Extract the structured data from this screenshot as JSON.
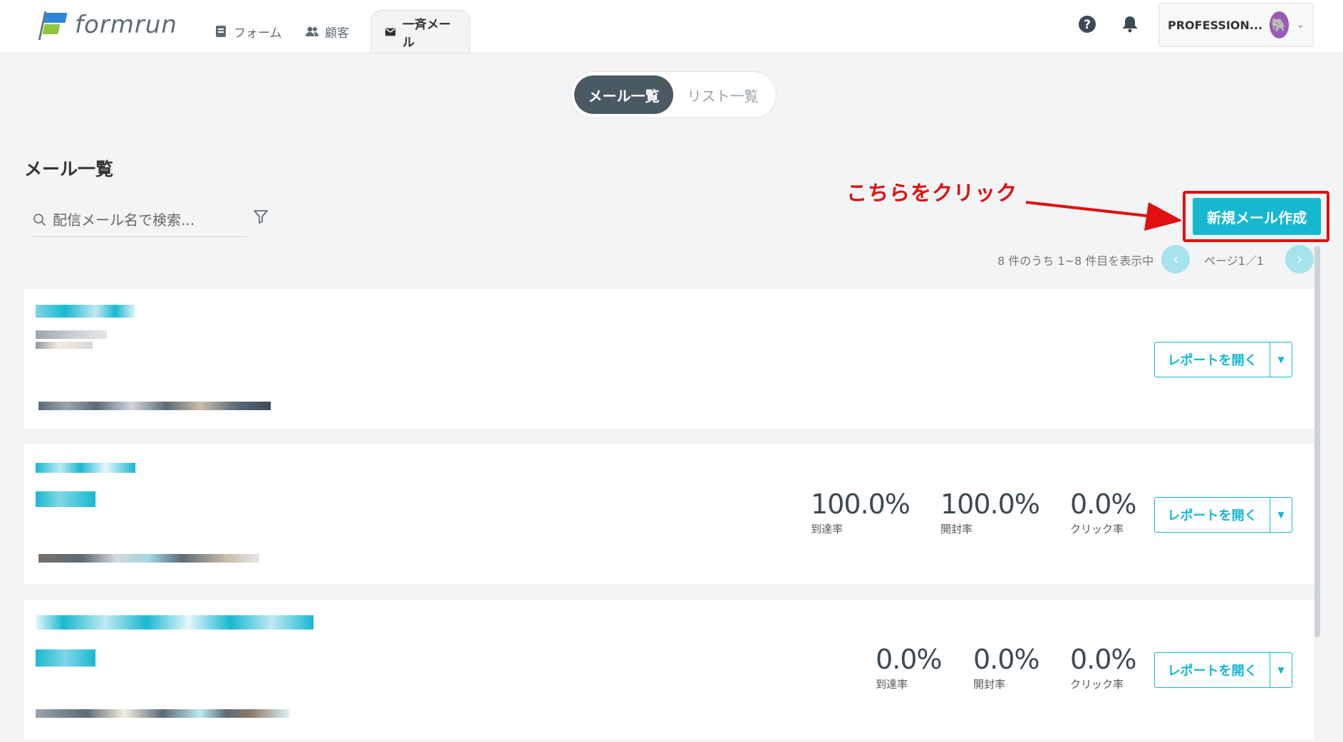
{
  "header": {
    "logo_text": "formrun",
    "nav": [
      {
        "label": "フォーム",
        "icon": "form-icon"
      },
      {
        "label": "顧客",
        "icon": "people-icon"
      },
      {
        "label": "一斉メール",
        "icon": "mail-icon"
      }
    ],
    "account_name": "PROFESSION...",
    "help_icon": "help-icon",
    "bell_icon": "bell-icon"
  },
  "segment": {
    "active": "メール一覧",
    "inactive": "リスト一覧"
  },
  "page_title": "メール一覧",
  "search": {
    "placeholder": "配信メール名で検索..."
  },
  "annotation": {
    "text": "こちらをクリック"
  },
  "create_button": "新規メール作成",
  "pager": {
    "info": "8 件のうち 1~8 件目を表示中",
    "page": "ページ1／1",
    "prev": "‹",
    "next": "›"
  },
  "cards": [
    {
      "report_label": "レポートを開く",
      "stats": []
    },
    {
      "report_label": "レポートを開く",
      "stats": [
        {
          "value": "100.0%",
          "label": "到達率"
        },
        {
          "value": "100.0%",
          "label": "開封率"
        },
        {
          "value": "0.0%",
          "label": "クリック率"
        }
      ]
    },
    {
      "report_label": "レポートを開く",
      "stats": [
        {
          "value": "0.0%",
          "label": "到達率"
        },
        {
          "value": "0.0%",
          "label": "開封率"
        },
        {
          "value": "0.0%",
          "label": "クリック率"
        }
      ]
    }
  ],
  "colors": {
    "accent": "#15b8d0",
    "annotation": "#e01010",
    "dark": "#4a5a63"
  }
}
